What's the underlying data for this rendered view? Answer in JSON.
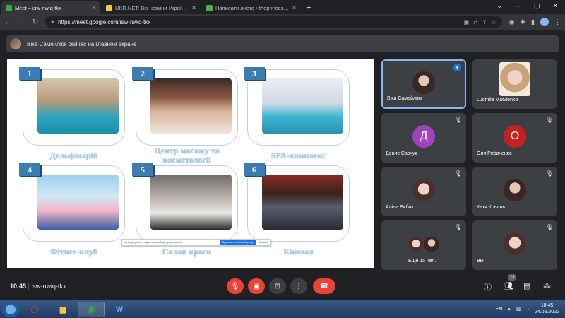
{
  "browser": {
    "tabs": [
      {
        "title": "Meet – isw-nwiq-tkx",
        "active": true,
        "favicon_color": "#34a853"
      },
      {
        "title": "UKR.NET: Всі новини України, о",
        "active": false,
        "favicon_color": "#f4c542"
      },
      {
        "title": "Написати листа • theprincess@",
        "active": false,
        "favicon_color": "#4caf50"
      }
    ],
    "url": "https://meet.google.com/isw-nwiq-tkx"
  },
  "banner": {
    "text": "Віка Самойлюк сейчас на главном экране"
  },
  "slide": {
    "cards": [
      {
        "num": "1",
        "caption": "Дельфінарій"
      },
      {
        "num": "2",
        "caption": "Центр масажу та косметології"
      },
      {
        "num": "3",
        "caption": "SPA-комплекс"
      },
      {
        "num": "4",
        "caption": "Фітнес-клуб"
      },
      {
        "num": "5",
        "caption": "Салон краси"
      },
      {
        "num": "6",
        "caption": "Кінозал"
      }
    ],
    "toast": {
      "text": "meet.google.com надає спільний доступ до екрана.",
      "button": "Припинити спільний доступ",
      "link": "Сховати"
    }
  },
  "participants": [
    {
      "name": "Віка Самойлюк",
      "initial": "",
      "speaking": true
    },
    {
      "name": "Ludmila Matvienko",
      "initial": ""
    },
    {
      "name": "Денис Савчук",
      "initial": "Д",
      "color": "#a142c1"
    },
    {
      "name": "Оля Рибаченко",
      "initial": "О",
      "color": "#c5221f"
    },
    {
      "name": "Аліна Рибак",
      "initial": ""
    },
    {
      "name": "Катя Коваль",
      "initial": ""
    },
    {
      "name": "Ещё 15 чел.",
      "initial": ""
    },
    {
      "name": "Вы",
      "initial": ""
    }
  ],
  "meet_bar": {
    "time": "10:45",
    "code": "isw-nwiq-tkx",
    "people_count": "23"
  },
  "taskbar": {
    "lang": "EN",
    "time": "10:45",
    "date": "24.05.2022"
  },
  "colors": {
    "accent": "#8ab4f8",
    "danger": "#ea4335",
    "slide_number": "#3b7cb3"
  }
}
